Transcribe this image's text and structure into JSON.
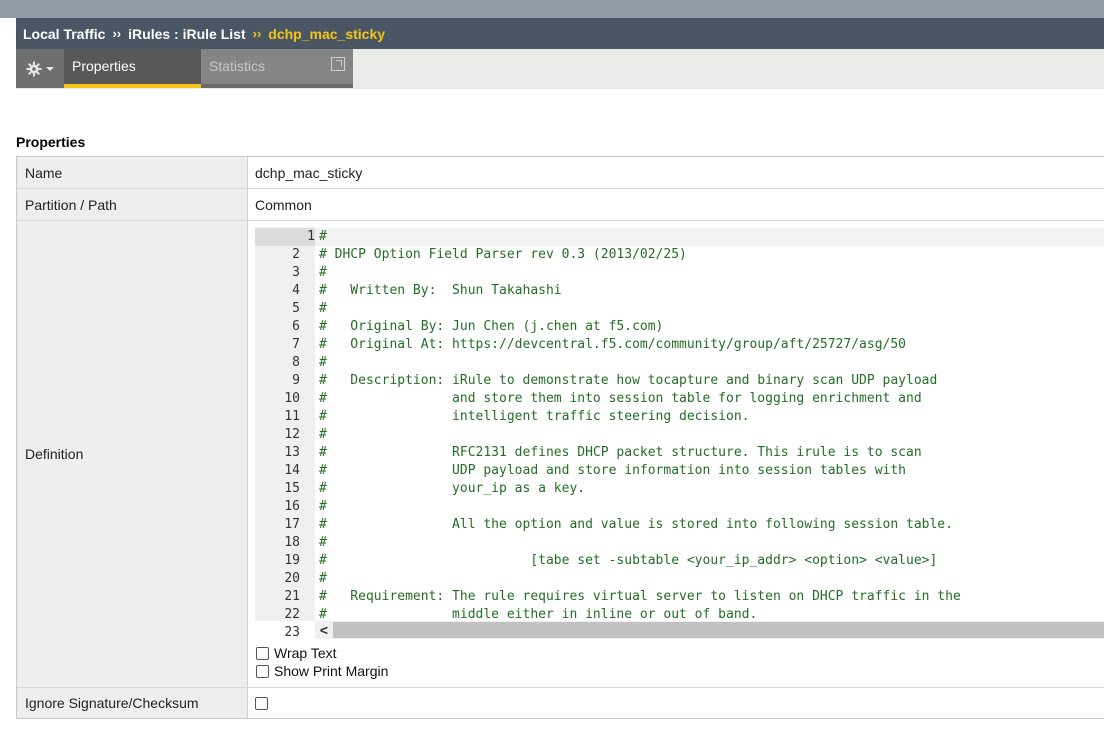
{
  "breadcrumb": {
    "items": [
      "Local Traffic",
      "iRules : iRule List"
    ],
    "separator": "››",
    "current": "dchp_mac_sticky"
  },
  "tabs": {
    "gear_icon": "gear-icon",
    "properties": "Properties",
    "statistics": "Statistics"
  },
  "section": {
    "title": "Properties"
  },
  "fields": {
    "name_label": "Name",
    "name_value": "dchp_mac_sticky",
    "partition_label": "Partition / Path",
    "partition_value": "Common",
    "definition_label": "Definition",
    "ignore_label": "Ignore Signature/Checksum"
  },
  "editor": {
    "lines": [
      "#",
      "# DHCP Option Field Parser rev 0.3 (2013/02/25)",
      "#",
      "#   Written By:  Shun Takahashi",
      "#",
      "#   Original By: Jun Chen (j.chen at f5.com)",
      "#   Original At: https://devcentral.f5.com/community/group/aft/25727/asg/50",
      "#",
      "#   Description: iRule to demonstrate how tocapture and binary scan UDP payload",
      "#                and store them into session table for logging enrichment and",
      "#                intelligent traffic steering decision.",
      "#",
      "#                RFC2131 defines DHCP packet structure. This irule is to scan",
      "#                UDP payload and store information into session tables with",
      "#                your_ip as a key.",
      "#",
      "#                All the option and value is stored into following session table.",
      "#",
      "#                          [tabe set -subtable <your_ip_addr> <option> <value>]",
      "#",
      "#   Requirement: The rule requires virtual server to listen on DHCP traffic in the",
      "#                middle either in inline or out of band.",
      ""
    ],
    "line_numbers": [
      "1",
      "2",
      "3",
      "4",
      "5",
      "6",
      "7",
      "8",
      "9",
      "10",
      "11",
      "12",
      "13",
      "14",
      "15",
      "16",
      "17",
      "18",
      "19",
      "20",
      "21",
      "22",
      "23"
    ],
    "scroll_left_glyph": "<"
  },
  "options": {
    "wrap_text": "Wrap Text",
    "show_print_margin": "Show Print Margin"
  },
  "colors": {
    "breadcrumb_bg": "#4a5663",
    "accent_yellow": "#f5c518",
    "code_green": "#236e25"
  }
}
